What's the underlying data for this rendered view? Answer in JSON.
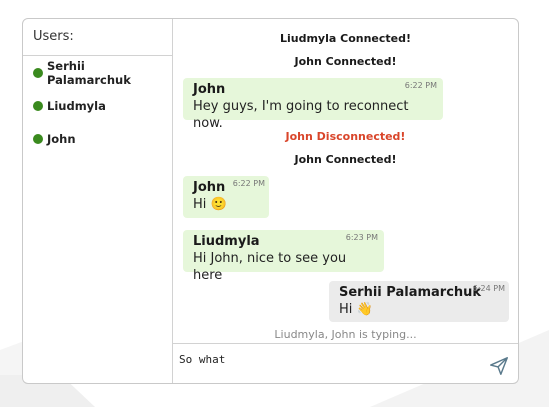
{
  "sidebar": {
    "header": "Users:",
    "users": [
      {
        "name": "Serhii Palamarchuk",
        "status": "online"
      },
      {
        "name": "Liudmyla",
        "status": "online"
      },
      {
        "name": "John",
        "status": "online"
      }
    ]
  },
  "messages": {
    "sys1": "Liudmyla Connected!",
    "sys2": "John Connected!",
    "m1": {
      "author": "John",
      "time": "6:22 PM",
      "text": "Hey guys, I'm going to reconnect now."
    },
    "sys3": "John Disconnected!",
    "sys4": "John Connected!",
    "m2": {
      "author": "John",
      "time": "6:22 PM",
      "text": "Hi 🙂"
    },
    "m3": {
      "author": "Liudmyla",
      "time": "6:23 PM",
      "text": "Hi John, nice to see you here"
    },
    "m4": {
      "author": "Serhii Palamarchuk",
      "time": "6:24 PM",
      "text": "Hi 👋"
    }
  },
  "typing_indicator": "Liudmyla, John is typing...",
  "composer": {
    "value": "So what"
  },
  "colors": {
    "online": "#3a8a1e",
    "disconnected": "#d9452a",
    "incoming_bubble": "#e6f7da",
    "outgoing_bubble": "#ebebeb"
  },
  "icons": {
    "send": "send-icon",
    "status": "online-dot-icon"
  }
}
